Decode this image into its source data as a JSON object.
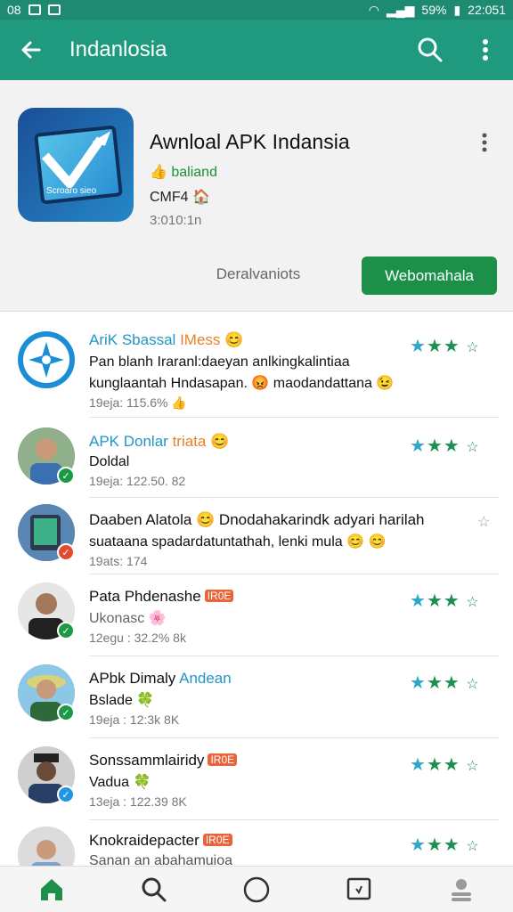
{
  "status_bar": {
    "left_text": "08",
    "battery": "59%",
    "time": "22:051"
  },
  "app_bar": {
    "title": "Indanlosia"
  },
  "hero": {
    "app_name": "Awnloal APK Indansia",
    "developer": "👍 baliand",
    "rating": "CMF4 🏠",
    "size": "3:010:1n",
    "secondary_button": "Deralvaniots",
    "primary_button": "Webomahala",
    "icon_caption": "Scroaro sieo"
  },
  "comments": [
    {
      "name": "AriK Sbassal",
      "name_suffix": "IMess 😊",
      "line2": "Pan blanh Iraranl:daeyan anlkingkalintiaa",
      "line3": "kunglaantah Hndasapan. 😡 maodandattana 😉",
      "meta": "19eja: 115.6% 👍",
      "stars": "★★★ ☆",
      "avatar": "logo",
      "badge": ""
    },
    {
      "name": "APK Donlar",
      "name_suffix": "triata 😊",
      "line2": "Doldal",
      "line3": "",
      "meta": "19eja: 122.50. 82",
      "stars": "★★★ ☆",
      "avatar": "man-blue",
      "badge": "✓"
    },
    {
      "name": "Daaben Alatola 😊 Dnodahakarindk adyari harilah",
      "name_suffix": "",
      "line2": "suataana spadardatuntathah, lenki mula 😊 😊",
      "line3": "",
      "meta": "19ats: 174",
      "stars": "☆",
      "avatar": "phone",
      "badge": "✓"
    },
    {
      "name": "Pata Phdenashe",
      "name_suffix": "IR0E",
      "line2": "Ukonasc 🌸",
      "line3": "",
      "meta": "12egu : 32.2% 8k",
      "stars": "★★★ ☆",
      "avatar": "man-suit",
      "badge": "✓"
    },
    {
      "name": "APbk Dimaly",
      "name_suffix": "Andean",
      "line2": "Bslade 🍀",
      "line3": "",
      "meta": "19eja : 12:3k 8K",
      "stars": "★★★ ☆",
      "avatar": "man-hat",
      "badge": "✓"
    },
    {
      "name": "Sonssammlairidy",
      "name_suffix": "IR0E",
      "line2": "Vadua 🍀",
      "line3": "",
      "meta": "13eja : 122.39 8K",
      "stars": "★★★ ☆",
      "avatar": "man-cap",
      "badge": "✓"
    },
    {
      "name": "Knokraidepacter",
      "name_suffix": "IR0E",
      "line2": "Sanan an abahamuioa",
      "line3": "",
      "meta": "",
      "stars": "★★★ ☆",
      "avatar": "man-plain",
      "badge": ""
    }
  ]
}
